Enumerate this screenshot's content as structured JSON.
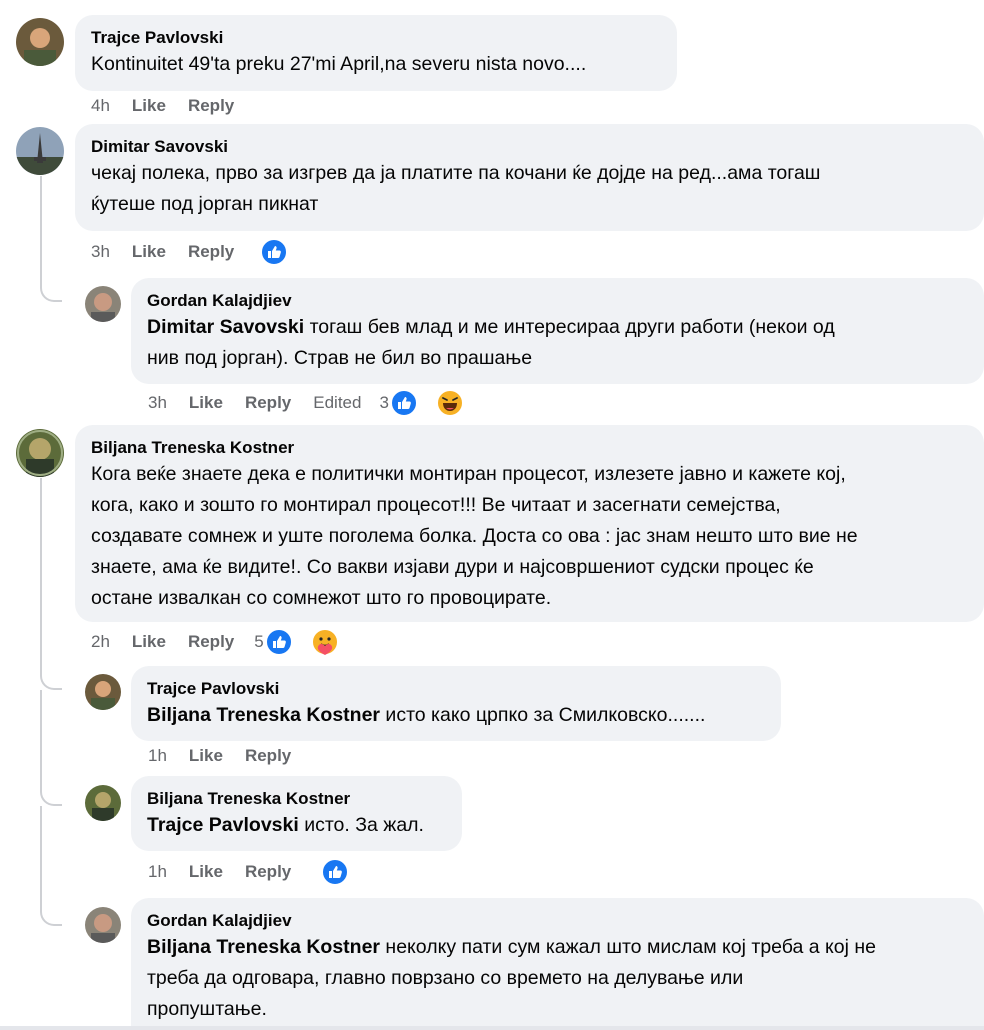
{
  "comments": [
    {
      "author": "Trajce Pavlovski",
      "text": "Kontinuitet 49'ta preku 27'mi April,na severu nista novo....",
      "time": "4h",
      "like": "Like",
      "reply": "Reply"
    },
    {
      "author": "Dimitar Savovski",
      "line1": "чекај полека, прво за изгрев да ја платите па кочани ќе дојде на ред...ама тогаш",
      "line2": "ќутеше под јорган пикнат",
      "time": "3h",
      "like": "Like",
      "reply": "Reply",
      "reaction_icons": [
        "like-reaction-icon"
      ]
    },
    {
      "author": "Gordan Kalajdjiev",
      "mention": "Dimitar Savovski",
      "line1": " тогаш бев млад и ме интересираа други работи (некои од",
      "line2": "нив под јорган). Страв не бил во прашање",
      "time": "3h",
      "like": "Like",
      "reply": "Reply",
      "edited": "Edited",
      "reaction_count": "3",
      "reaction_icons": [
        "like-reaction-icon",
        "haha-reaction-icon"
      ]
    },
    {
      "author": "Biljana Treneska Kostner",
      "lines": [
        "Кога веќе знаете дека е политички монтиран процесот, излезете јавно и кажете кој,",
        "кога, како и зошто го монтирал процесот!!! Ве читаат и засегнати семејства,",
        "создавате сомнеж и уште поголема болка. Доста со ова : јас знам нешто што вие не",
        "знаете, ама ќе видите!. Со вакви изјави дури и најсовршениот судски процес ќе",
        "остане извалкан со сомнежот што го провоцирате."
      ],
      "time": "2h",
      "like": "Like",
      "reply": "Reply",
      "reaction_count": "5",
      "reaction_icons": [
        "like-reaction-icon",
        "care-reaction-icon"
      ]
    },
    {
      "author": "Trajce Pavlovski",
      "mention": "Biljana Treneska Kostner",
      "text": " исто како црпко за Смилковско.......",
      "time": "1h",
      "like": "Like",
      "reply": "Reply"
    },
    {
      "author": "Biljana Treneska Kostner",
      "mention": "Trajce Pavlovski",
      "text": " исто. За жал.",
      "time": "1h",
      "like": "Like",
      "reply": "Reply",
      "reaction_icons": [
        "like-reaction-icon"
      ]
    },
    {
      "author": "Gordan Kalajdjiev",
      "mention": "Biljana Treneska Kostner",
      "line1": " неколку пати сум кажал што мислам кој треба а кој не",
      "line2": "треба да одговара, главно поврзано со времето на делување или",
      "line3": "пропуштање."
    }
  ],
  "colors": {
    "bubble": "#f0f2f5",
    "meta": "#65676b",
    "like_blue": "#1877f2",
    "haha_yellow": "#f7b125"
  }
}
